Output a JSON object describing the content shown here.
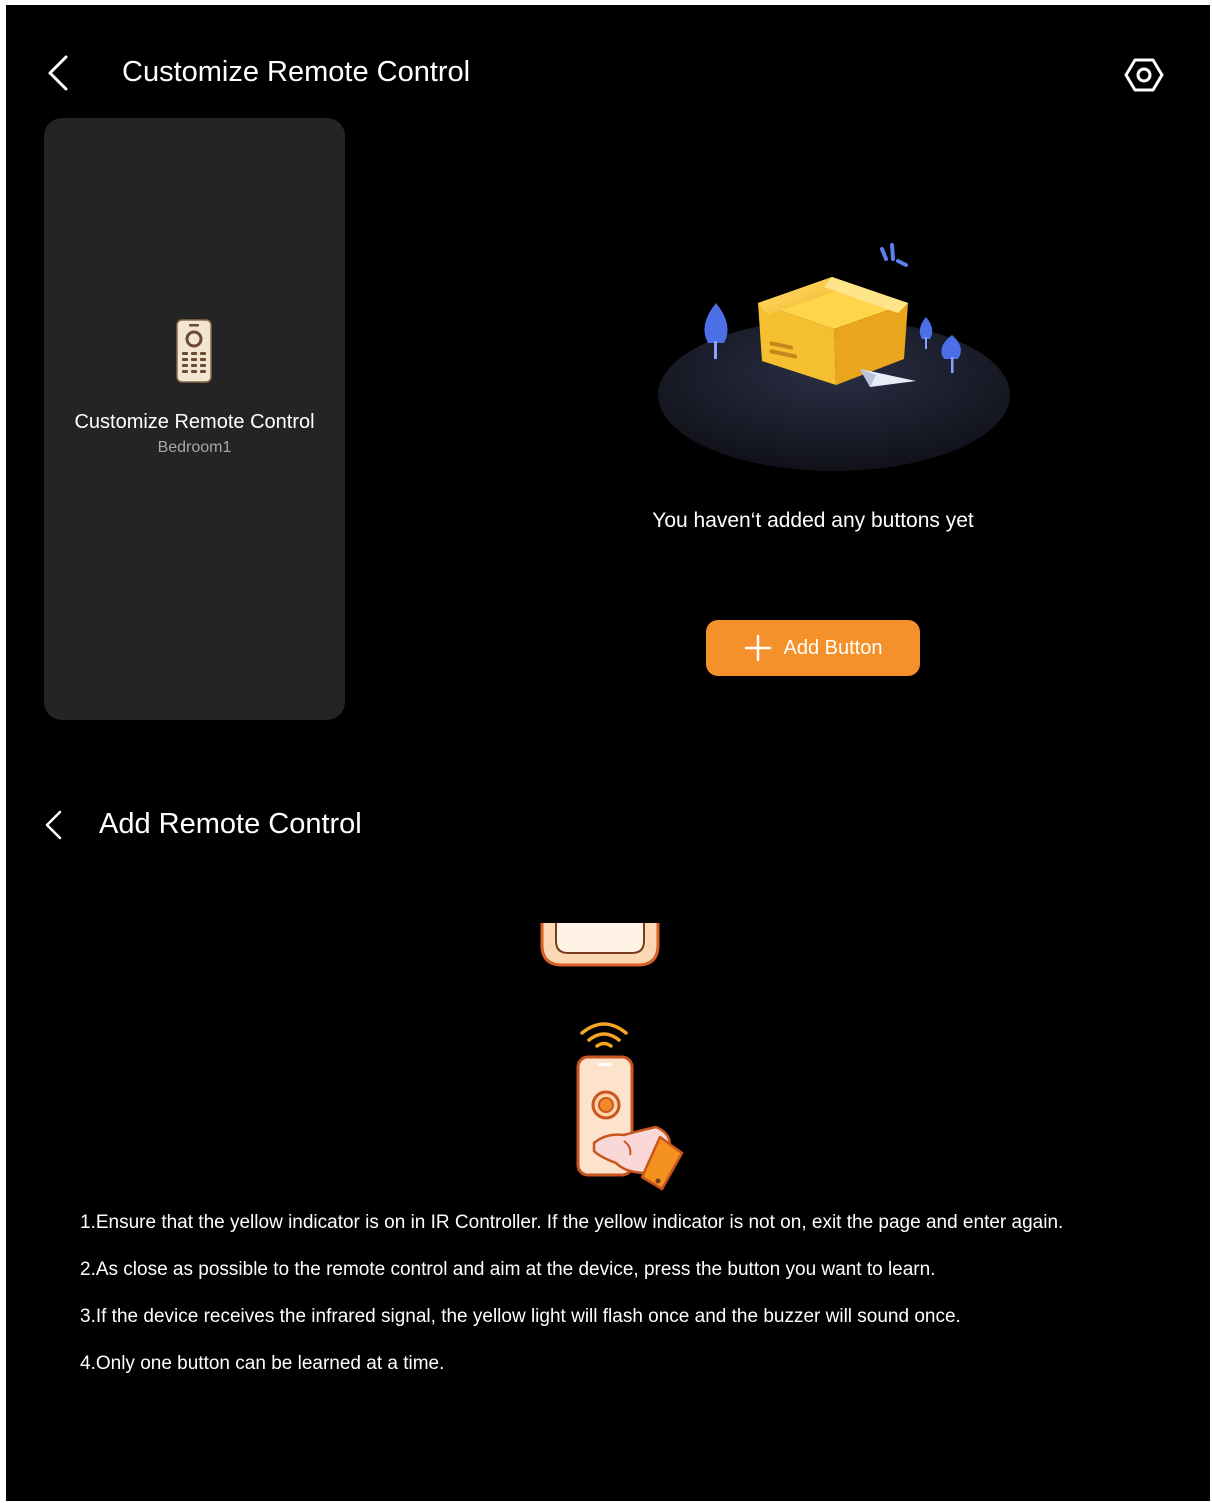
{
  "header": {
    "title": "Customize Remote Control",
    "back_icon": "chevron-left-icon",
    "settings_icon": "settings-hexagon-icon"
  },
  "device_card": {
    "icon": "remote-control-icon",
    "title": "Customize Remote Control",
    "subtitle": "Bedroom1"
  },
  "empty_state": {
    "illustration": "empty-box-illustration",
    "message": "You haven‘t added any buttons yet",
    "add_button_label": "Add Button",
    "add_icon": "plus-icon"
  },
  "learn_section": {
    "title": "Add Remote Control",
    "back_icon": "chevron-left-icon",
    "illustration": "hand-remote-signal-illustration",
    "instructions": [
      "1.Ensure that the yellow indicator is on in IR Controller. If the yellow indicator is not on, exit the page and enter again.",
      "2.As close as possible to the remote control and aim at the device, press the button you want to learn.",
      "3.If the device receives the infrared signal, the yellow light will flash once and the buzzer will sound once.",
      "4.Only one button can be learned at a time."
    ]
  },
  "colors": {
    "background": "#000000",
    "card": "#242424",
    "accent": "#f5912a",
    "subtitle": "#a7a7a7"
  }
}
